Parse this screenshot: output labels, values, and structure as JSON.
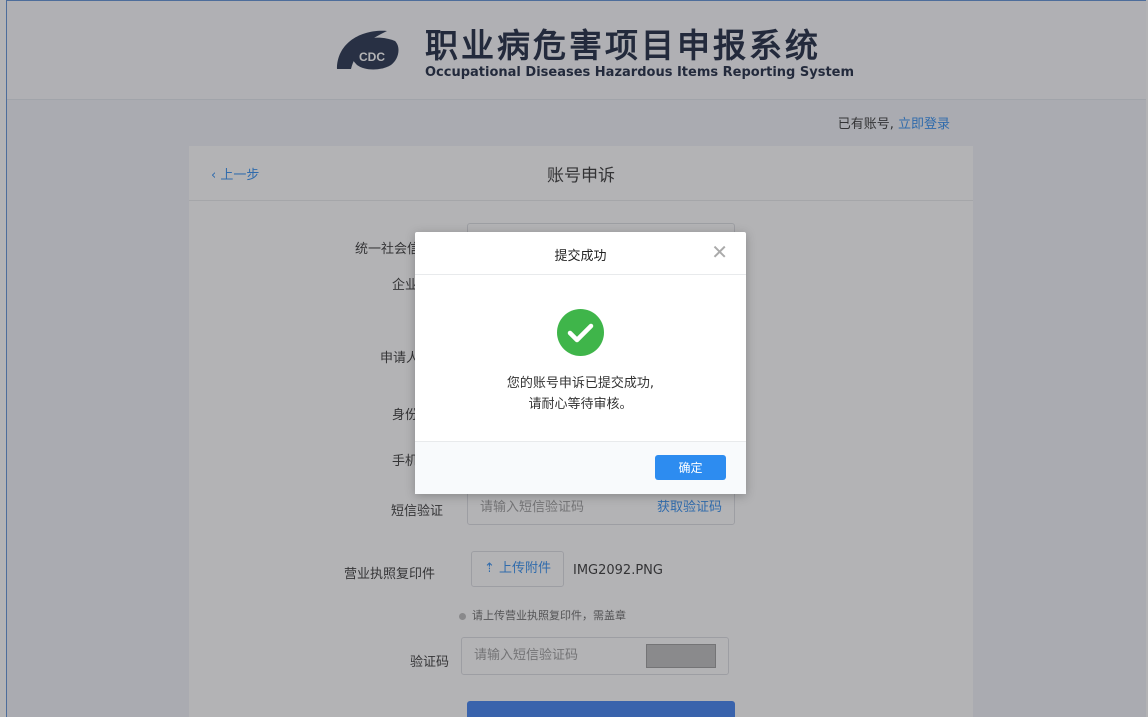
{
  "header": {
    "title_zh": "职业病危害项目申报系统",
    "title_en": "Occupational Diseases Hazardous Items Reporting System",
    "logo_text": "CDC"
  },
  "account_prompt": {
    "text": "已有账号,",
    "link": "立即登录"
  },
  "card": {
    "back_label": "上一步",
    "title": "账号申诉"
  },
  "form": {
    "labels": {
      "credit_code": "统一社会信用",
      "company": "企业",
      "applicant": "申请人",
      "id_card": "身份",
      "phone": "手机",
      "sms_code": "短信验证",
      "license": "营业执照复印件",
      "captcha": "验证码"
    },
    "sms_placeholder": "请输入短信验证码",
    "sms_button": "获取验证码",
    "upload_button": "上传附件",
    "upload_file": "IMG2092.PNG",
    "upload_hint": "请上传营业执照复印件，需盖章",
    "captcha_placeholder": "请输入短信验证码"
  },
  "modal": {
    "title": "提交成功",
    "message_line1": "您的账号申诉已提交成功,",
    "message_line2": "请耐心等待审核。",
    "ok_button": "确定"
  },
  "colors": {
    "accent": "#2d8cf0",
    "success": "#3fb54a",
    "title_text": "#17233d"
  },
  "icons": {
    "close": "close-icon",
    "check": "check-circle-icon",
    "upload": "upload-icon",
    "back": "chevron-left-icon"
  }
}
